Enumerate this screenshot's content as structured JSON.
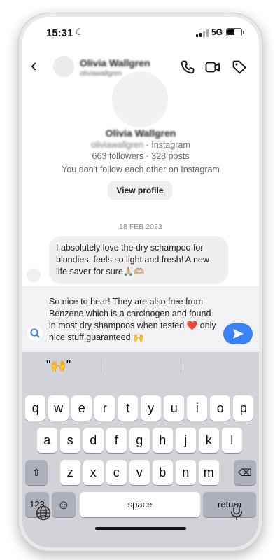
{
  "status_bar": {
    "time": "15:31",
    "network": "5G",
    "battery_level": 0.55
  },
  "header": {
    "contact_name": "Olivia Wallgren",
    "username": "oliviawallgren"
  },
  "profile": {
    "name": "Olivia Wallgren",
    "username": "oliviawallgren",
    "platform": " · Instagram",
    "stats": "663 followers · 328 posts",
    "follow_note": "You don't follow each other on Instagram",
    "view_profile_label": "View profile"
  },
  "thread": {
    "date": "18 FEB 2023",
    "incoming_message": "I absolutely love the dry schampoo for blondies, feels so light and fresh! A new life saver for sure🙏🏼🫶🏼"
  },
  "composer": {
    "draft_text": "So nice to hear! They are also free from Benzene which is a carcinogen and found in most dry shampoos when tested ❤️ only nice stuff guaranteed 🙌"
  },
  "keyboard": {
    "suggestion": "\"🙌\"",
    "row1": [
      "q",
      "w",
      "e",
      "r",
      "t",
      "y",
      "u",
      "i",
      "o",
      "p"
    ],
    "row2": [
      "a",
      "s",
      "d",
      "f",
      "g",
      "h",
      "j",
      "k",
      "l"
    ],
    "row3": [
      "z",
      "x",
      "c",
      "v",
      "b",
      "n",
      "m"
    ],
    "shift_symbol": "⇧",
    "delete_symbol": "⌫",
    "numbers_label": "123",
    "emoji_symbol": "☺",
    "space_label": "space",
    "return_label": "return"
  },
  "icons": {
    "back": "chevron-left-icon",
    "call": "phone-icon",
    "video": "video-icon",
    "tag": "tag-icon",
    "search": "search-icon",
    "send": "send-icon",
    "globe": "globe-icon",
    "mic": "microphone-icon"
  },
  "colors": {
    "accent": "#3b82f6",
    "bubble": "#efefef",
    "keyboard": "#d1d3d9"
  }
}
